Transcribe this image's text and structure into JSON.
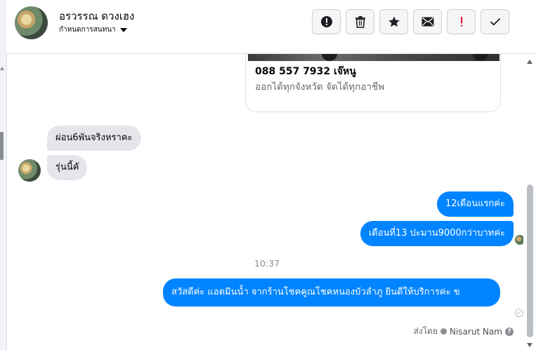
{
  "header": {
    "contact_name": "อรวรรณ ดวงเฮง",
    "conversation_setting": "กำหนดการสนทนา",
    "toolbar": [
      {
        "name": "spam",
        "icon": "exclamation-circle-icon"
      },
      {
        "name": "delete",
        "icon": "trash-icon"
      },
      {
        "name": "star",
        "icon": "star-icon"
      },
      {
        "name": "mark-unread",
        "icon": "envelope-icon"
      },
      {
        "name": "follow-up",
        "icon": "red-exclamation-icon"
      },
      {
        "name": "done",
        "icon": "checkmark-icon"
      }
    ]
  },
  "card": {
    "title": "088 557 7932 เจ๊หนู",
    "subtitle": "ออกได้ทุกจังหวัด จัดได้ทุกอาชีพ"
  },
  "messages": {
    "incoming": [
      "ผ่อน6พันจริงหราคะ",
      "รุ่นนี้คั"
    ],
    "outgoing": [
      "12เดือนแรกค่ะ",
      "เดือนที่13 ปะมาน9000กว่าบาทค่ะ"
    ],
    "timestamp": "10:37",
    "latest_outgoing": "สวัสดีค่ะ แอดมินน้ำ จากร้านโชคคูณโชคหนองบัวลำภู ยินดีให้บริการค่ะ ข",
    "sent_by_label": "ส่งโดย",
    "sent_by_name": "Nisarut Nam",
    "help_glyph": "?"
  },
  "colors": {
    "outgoing_bubble": "#0084ff",
    "incoming_bubble": "#e4e6eb",
    "follow_up_red": "#e41e3f"
  }
}
